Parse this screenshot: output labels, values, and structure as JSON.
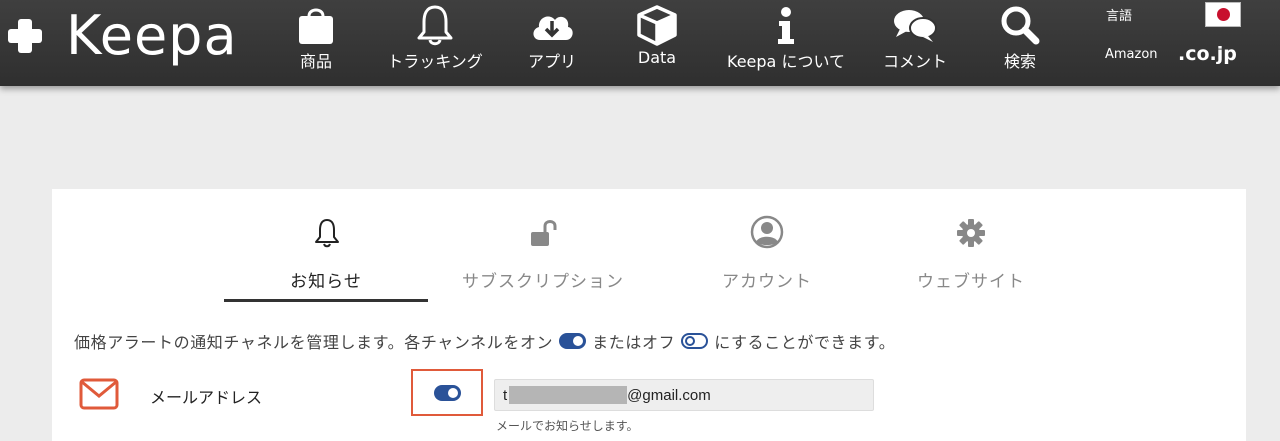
{
  "brand": {
    "name": "Keepa"
  },
  "nav": {
    "items": [
      {
        "label": "商品",
        "icon": "shopping-bag-icon"
      },
      {
        "label": "トラッキング",
        "icon": "bell-icon"
      },
      {
        "label": "アプリ",
        "icon": "cloud-download-icon"
      },
      {
        "label": "Data",
        "icon": "cube-icon"
      },
      {
        "label": "Keepa について",
        "icon": "info-icon"
      },
      {
        "label": "コメント",
        "icon": "chat-bubbles-icon"
      },
      {
        "label": "検索",
        "icon": "search-icon"
      }
    ],
    "language_label": "言語",
    "amazon_label": "Amazon",
    "domain": ".co.jp"
  },
  "tabs": [
    {
      "label": "お知らせ",
      "icon": "bell-icon",
      "active": true
    },
    {
      "label": "サブスクリプション",
      "icon": "unlock-icon",
      "active": false
    },
    {
      "label": "アカウント",
      "icon": "user-circle-icon",
      "active": false
    },
    {
      "label": "ウェブサイト",
      "icon": "gear-icon",
      "active": false
    }
  ],
  "notifications": {
    "description_part1": "価格アラートの通知チャネルを管理します。各チャンネルをオン",
    "description_part2": "またはオフ",
    "description_part3": "にすることができます。",
    "email": {
      "label": "メールアドレス",
      "enabled": true,
      "value_prefix": "t",
      "value_suffix": "@gmail.com",
      "hint": "メールでお知らせします。"
    }
  },
  "colors": {
    "accent": "#2a5298",
    "highlight": "#e05a3a",
    "topbar": "#333333"
  }
}
